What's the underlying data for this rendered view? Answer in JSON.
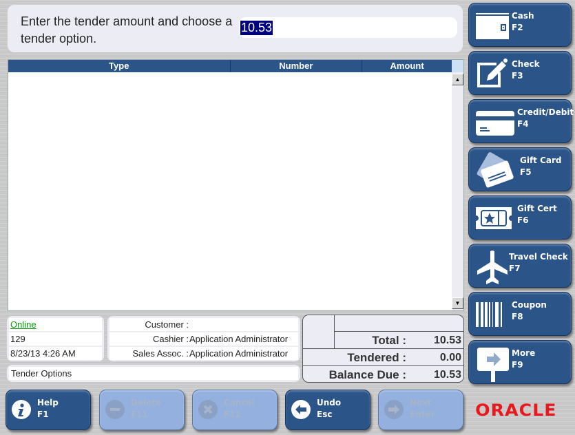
{
  "prompt": {
    "text": "Enter the tender amount and choose a tender option.",
    "amount_value": "10.53"
  },
  "grid": {
    "columns": [
      "Type",
      "Number",
      "Amount"
    ],
    "rows": []
  },
  "status": {
    "online": "Online",
    "register": "129",
    "datetime": "8/23/13 4:26 AM"
  },
  "user_info": {
    "customer_label": "Customer :",
    "customer_value": "",
    "cashier_label": "Cashier :",
    "cashier_value": "Application Administrator",
    "sales_assoc_label": "Sales Assoc. :",
    "sales_assoc_value": "Application Administrator"
  },
  "tender_options_label": "Tender Options",
  "totals": {
    "total_label": "Total :",
    "total_value": "10.53",
    "tendered_label": "Tendered :",
    "tendered_value": "0.00",
    "balance_label": "Balance Due :",
    "balance_value": "10.53"
  },
  "tender_buttons": [
    {
      "label": "Cash",
      "key": "F2",
      "icon": "wallet-icon"
    },
    {
      "label": "Check",
      "key": "F3",
      "icon": "pencil-check-icon"
    },
    {
      "label": "Credit/Debit",
      "key": "F4",
      "icon": "credit-card-icon"
    },
    {
      "label": "Gift Card",
      "key": "F5",
      "icon": "gift-card-icon"
    },
    {
      "label": "Gift Cert",
      "key": "F6",
      "icon": "ticket-star-icon"
    },
    {
      "label": "Travel Check",
      "key": "F7",
      "icon": "airplane-icon"
    },
    {
      "label": "Coupon",
      "key": "F8",
      "icon": "barcode-icon"
    },
    {
      "label": "More",
      "key": "F9",
      "icon": "arrow-sign-icon"
    }
  ],
  "bottom_buttons": [
    {
      "label": "Help",
      "key": "F1",
      "enabled": true,
      "icon": "info-icon"
    },
    {
      "label": "Delete",
      "key": "F11",
      "enabled": false,
      "icon": "minus-circle-icon"
    },
    {
      "label": "Cancel",
      "key": "F12",
      "enabled": false,
      "icon": "x-circle-icon"
    },
    {
      "label": "Undo",
      "key": "Esc",
      "enabled": true,
      "icon": "arrow-left-circle-icon"
    },
    {
      "label": "Next",
      "key": "Enter",
      "enabled": false,
      "icon": "arrow-right-circle-icon"
    }
  ],
  "brand": {
    "logo_text": "ORACLE",
    "color": "#e8191e"
  },
  "colors": {
    "button_blue": "#2b5488",
    "button_disabled": "#93b0de",
    "header_blue": "#2b5488",
    "online_green": "#0a9a0a"
  }
}
